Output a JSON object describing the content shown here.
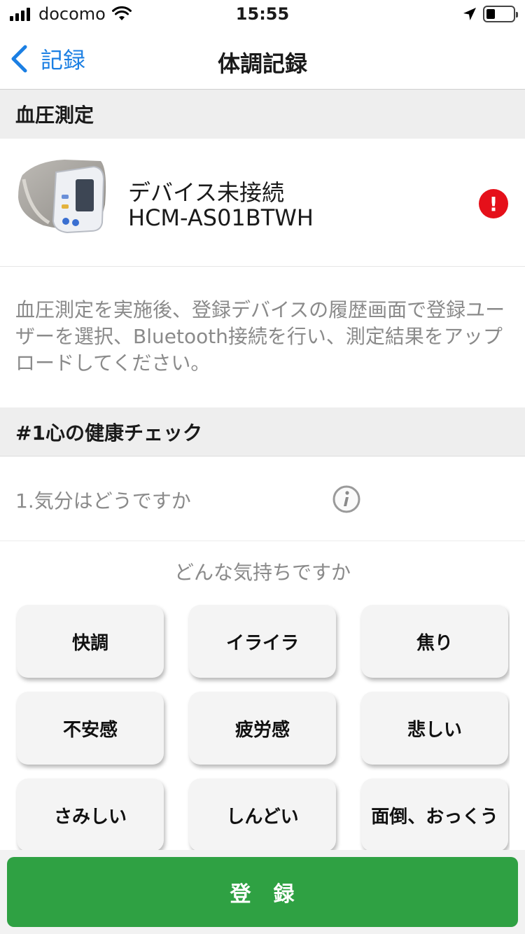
{
  "status_bar": {
    "carrier": "docomo",
    "time": "15:55",
    "icons": [
      "signal-bars-icon",
      "wifi-icon",
      "location-arrow-icon",
      "battery-icon"
    ]
  },
  "nav": {
    "back_label": "記録",
    "title": "体調記録",
    "accent": "#1b7fe3"
  },
  "blood_pressure": {
    "section_title": "血圧測定",
    "device_status": "デバイス未接続",
    "device_model": "HCM-AS01BTWH",
    "alert_icon": "exclamation-circle-icon",
    "alert_color": "#e5101a",
    "alert_symbol": "!",
    "info_text": "血圧測定を実施後、登録デバイスの履歴画面で登録ユーザーを選択、Bluetooth接続を行い、測定結果をアップロードしてください。"
  },
  "health_check": {
    "section_title": "#1心の健康チェック",
    "question": "1.気分はどうですか",
    "info_icon": "info-circle-icon",
    "prompt": "どんな気持ちですか",
    "moods": [
      "快調",
      "イライラ",
      "焦り",
      "不安感",
      "疲労感",
      "悲しい",
      "さみしい",
      "しんどい",
      "面倒、おっくう"
    ]
  },
  "footer": {
    "register_label": "登　録",
    "button_color": "#2fa143"
  }
}
